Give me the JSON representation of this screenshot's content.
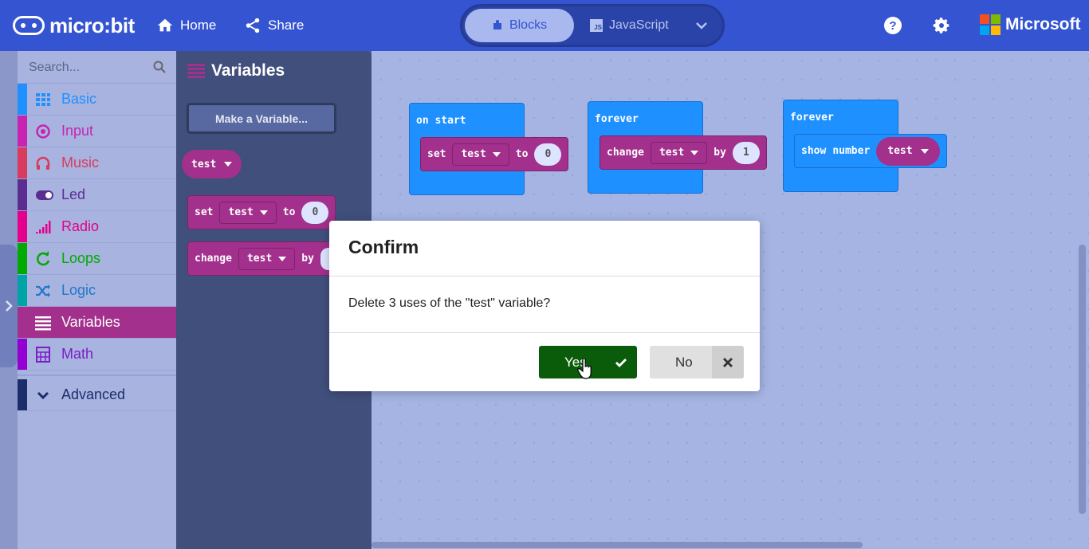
{
  "header": {
    "logo_text": "micro:bit",
    "home_label": "Home",
    "share_label": "Share",
    "editor_toggle": {
      "blocks_label": "Blocks",
      "js_label": "JavaScript",
      "js_badge": "JS"
    },
    "brand_text": "Microsoft"
  },
  "toolbox": {
    "search_placeholder": "Search...",
    "categories": [
      {
        "label": "Basic",
        "color": "#1e90ff",
        "icon": "grid-icon"
      },
      {
        "label": "Input",
        "color": "#c724b1",
        "icon": "target-icon"
      },
      {
        "label": "Music",
        "color": "#d83b5e",
        "icon": "headphones-icon"
      },
      {
        "label": "Led",
        "color": "#5c2d91",
        "icon": "toggle-icon"
      },
      {
        "label": "Radio",
        "color": "#e3008c",
        "icon": "signal-bars-icon"
      },
      {
        "label": "Loops",
        "color": "#00aa00",
        "icon": "refresh-icon"
      },
      {
        "label": "Logic",
        "color": "#00a4a6",
        "icon": "shuffle-icon"
      },
      {
        "label": "Variables",
        "color": "#dc143c",
        "icon": "lines-icon",
        "selected": true
      },
      {
        "label": "Math",
        "color": "#9400d3",
        "icon": "calculator-icon"
      }
    ],
    "advanced_label": "Advanced"
  },
  "flyout": {
    "title": "Variables",
    "make_variable_label": "Make a Variable...",
    "var_name": "test",
    "set_block": {
      "kw": "set",
      "var": "test",
      "to": "to",
      "value": "0"
    },
    "change_block": {
      "kw": "change",
      "var": "test",
      "by": "by"
    }
  },
  "workspace": {
    "on_start": {
      "label": "on start",
      "set_kw": "set",
      "var": "test",
      "to": "to",
      "value": "0"
    },
    "forever1": {
      "label": "forever",
      "change_kw": "change",
      "var": "test",
      "by": "by",
      "value": "1"
    },
    "forever2": {
      "label": "forever",
      "show_kw": "show",
      "number_kw": "number",
      "var": "test"
    }
  },
  "dialog": {
    "title": "Confirm",
    "message": "Delete 3 uses of the \"test\" variable?",
    "yes_label": "Yes",
    "no_label": "No"
  },
  "colors": {
    "header": "#3454d1",
    "variables": "#a2308c",
    "event_block": "#1e90ff",
    "yes_button": "#0a5c0a"
  }
}
